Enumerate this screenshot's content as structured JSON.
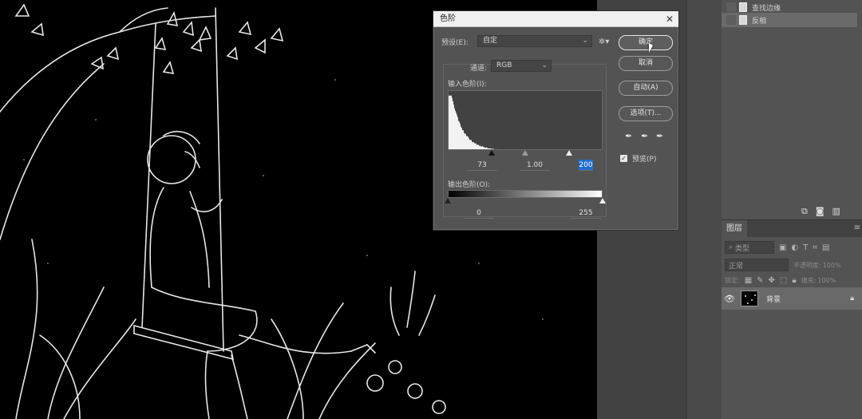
{
  "app": {
    "accent": "#1f6fd1",
    "canvas_bg": "#000000",
    "panel_bg": "#535353"
  },
  "history_panel": {
    "items": [
      {
        "label": "查找边缘",
        "icon": "document-icon"
      },
      {
        "label": "反相",
        "icon": "document-icon"
      }
    ],
    "footer_icons": [
      "new-snapshot-icon",
      "camera-icon",
      "trash-icon"
    ]
  },
  "layers_panel": {
    "tab_label": "图层",
    "filter_placeholder": "类型",
    "blend_mode": "正常",
    "opacity_label": "不透明度:",
    "opacity_value": "100%",
    "lock_label": "锁定:",
    "fill_label": "填充:",
    "fill_value": "100%",
    "layers": [
      {
        "name": "背景",
        "visible": true,
        "locked": true
      }
    ]
  },
  "levels_dialog": {
    "title": "色阶",
    "close": "✕",
    "preset_label": "预设(E):",
    "preset_value": "自定",
    "channel_label": "通道:",
    "channel_value": "RGB",
    "input_label": "输入色阶(I):",
    "input_values": {
      "shadow": "73",
      "midtone": "1.00",
      "highlight": "200"
    },
    "input_slider_positions": {
      "shadow": 0.286,
      "midtone": 0.5,
      "highlight": 0.784
    },
    "output_label": "输出色阶(O):",
    "output_values": {
      "min": "0",
      "max": "255"
    },
    "buttons": {
      "ok": "确定",
      "cancel": "取消",
      "auto": "自动(A)",
      "options": "选项(T)..."
    },
    "preview_label": "预览(P)",
    "preview_checked": true,
    "histogram_peak_bin": 0.03
  }
}
